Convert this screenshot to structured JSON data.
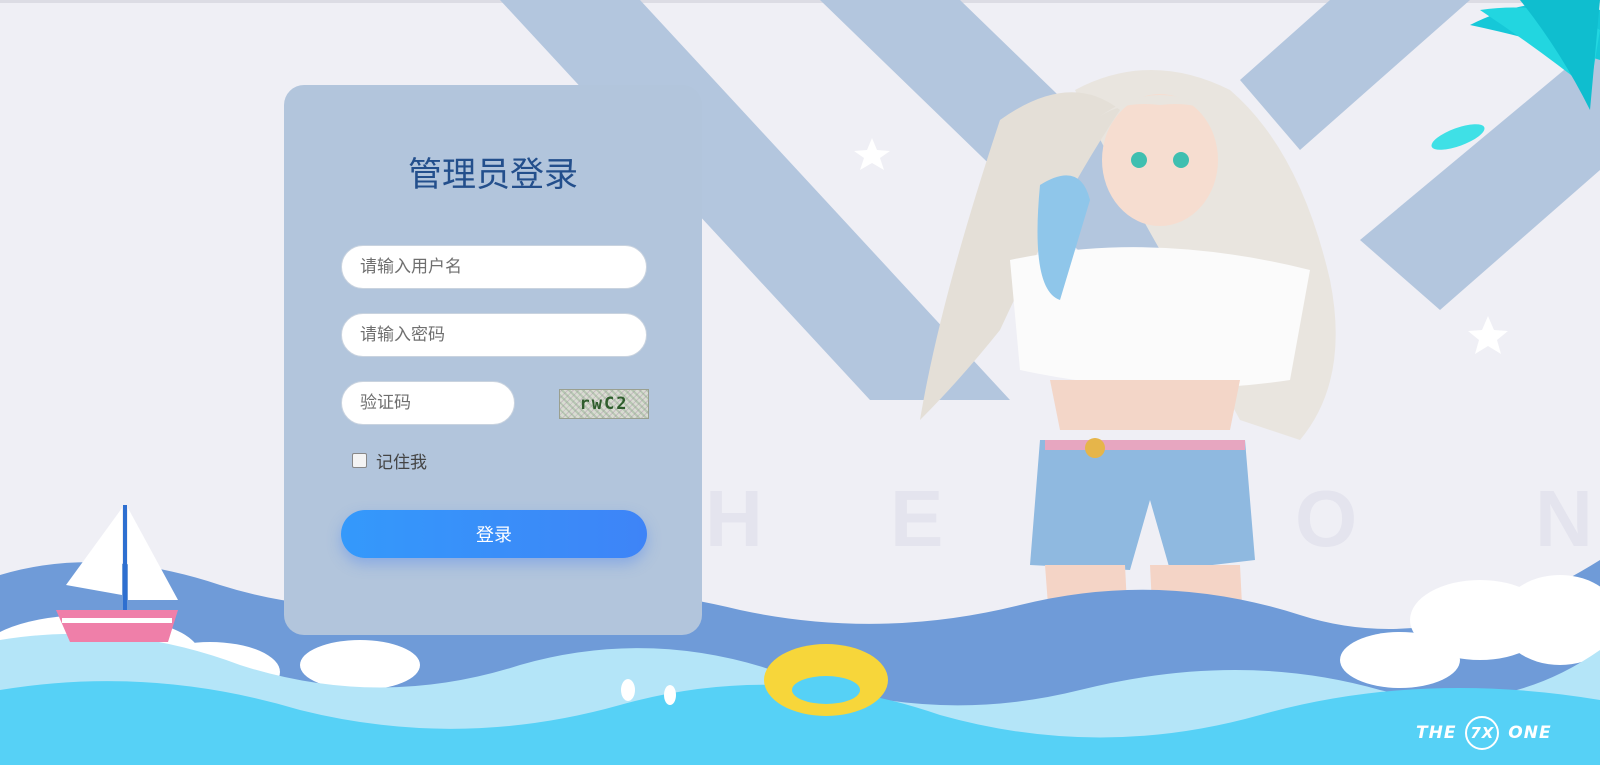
{
  "login": {
    "title": "管理员登录",
    "username_placeholder": "请输入用户名",
    "password_placeholder": "请输入密码",
    "captcha_placeholder": "验证码",
    "captcha_text": "rwC2",
    "remember_label": "记住我",
    "submit_label": "登录"
  },
  "background": {
    "watermark_letters": [
      "H",
      "E",
      "O",
      "N"
    ],
    "brand_left": "THE",
    "brand_mark": "7X",
    "brand_right": "ONE"
  },
  "colors": {
    "card": "#b2c5dc",
    "title": "#234f8c",
    "button_start": "#3499fb",
    "button_end": "#3e84f7",
    "stripes": "#b3c6de",
    "wave_dark": "#6f9bd8",
    "wave_light": "#56d1f6"
  }
}
